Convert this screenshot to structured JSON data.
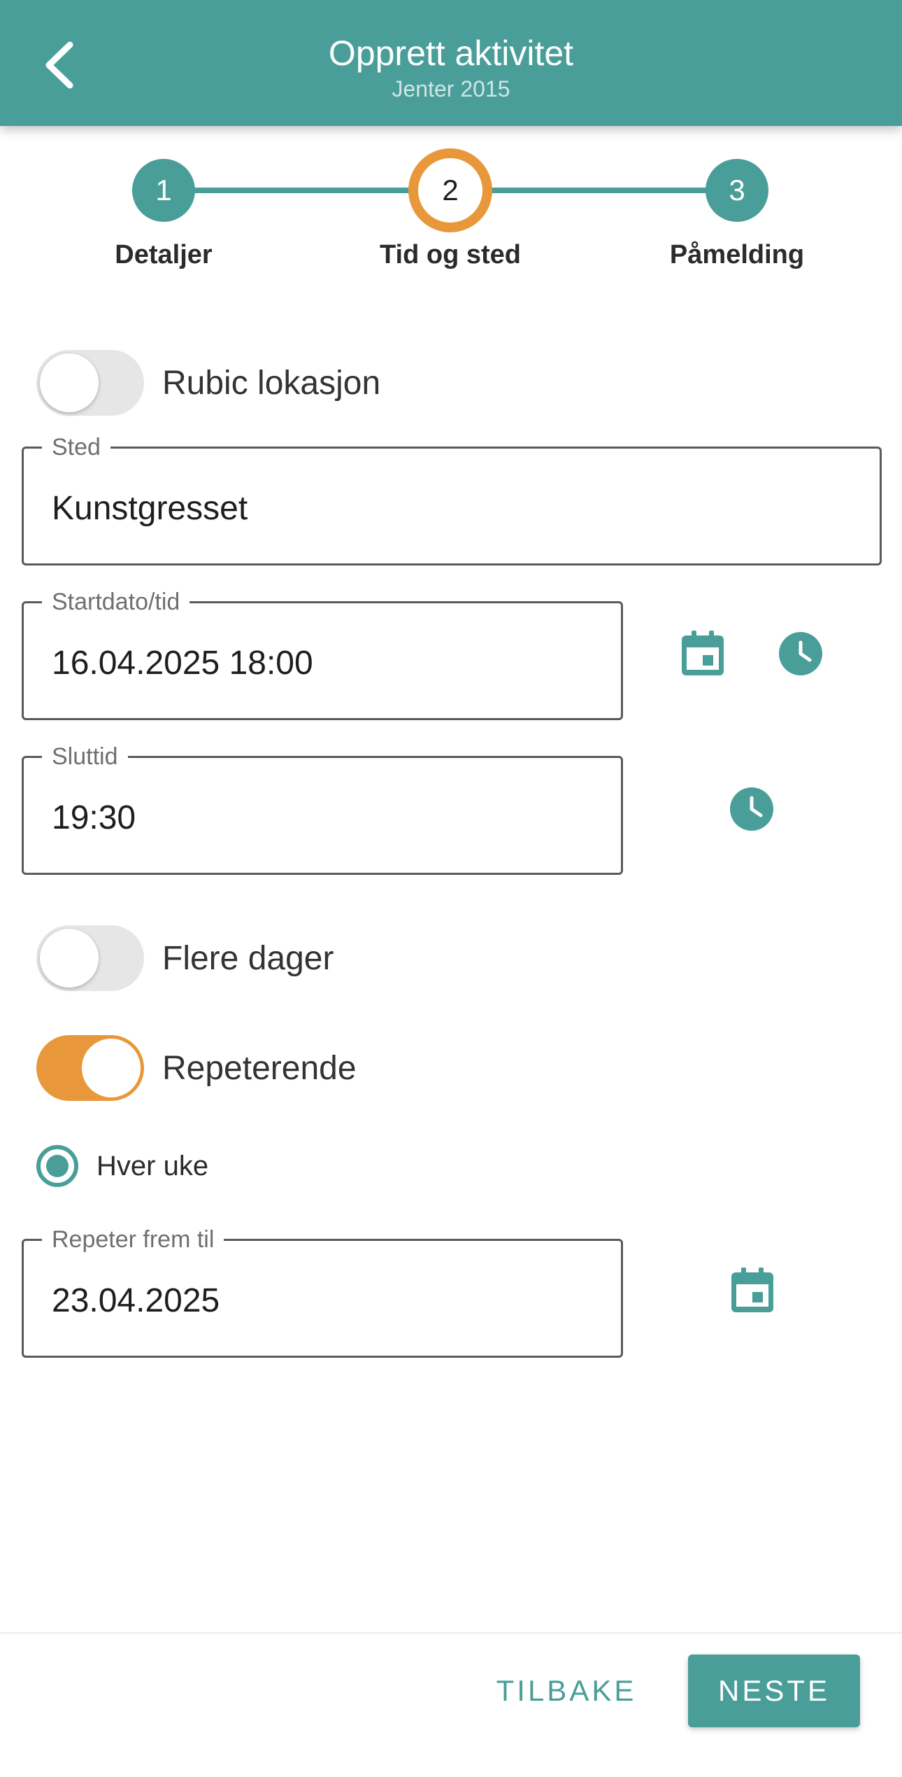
{
  "header": {
    "title": "Opprett aktivitet",
    "subtitle": "Jenter 2015",
    "back_icon": "chevron-left-icon"
  },
  "stepper": {
    "current_step": 2,
    "steps": [
      {
        "number": "1",
        "label": "Detaljer"
      },
      {
        "number": "2",
        "label": "Tid og sted"
      },
      {
        "number": "3",
        "label": "Påmelding"
      }
    ]
  },
  "form": {
    "rubic_location": {
      "label": "Rubic lokasjon",
      "on": false
    },
    "location": {
      "label": "Sted",
      "value": "Kunstgresset"
    },
    "start": {
      "label": "Startdato/tid",
      "value": "16.04.2025 18:00"
    },
    "end": {
      "label": "Sluttid",
      "value": "19:30"
    },
    "multiple_days": {
      "label": "Flere dager",
      "on": false
    },
    "repeating": {
      "label": "Repeterende",
      "on": true
    },
    "frequency": {
      "label": "Hver uke",
      "selected": true
    },
    "repeat_until": {
      "label": "Repeter frem til",
      "value": "23.04.2025"
    }
  },
  "footer": {
    "back_label": "TILBAKE",
    "next_label": "NESTE"
  },
  "colors": {
    "primary": "#4a9e99",
    "accent": "#e8983a",
    "toggle_off": "#e6e6e6"
  }
}
